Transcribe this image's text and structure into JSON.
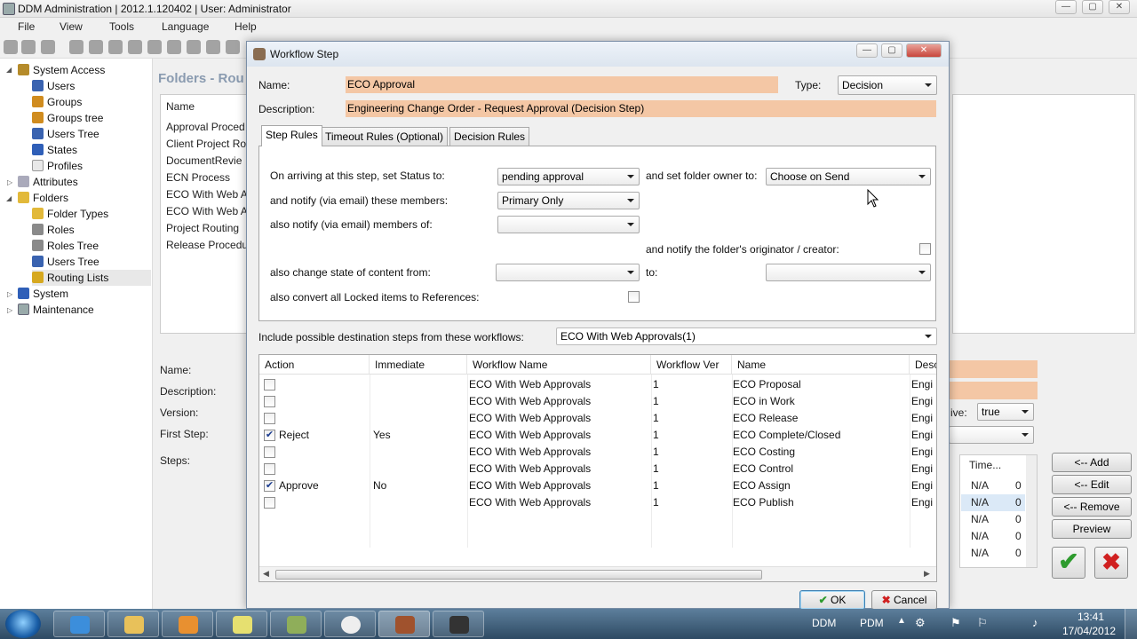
{
  "window": {
    "title": "DDM Administration | 2012.1.120402 | User:  Administrator",
    "buttons": {
      "minimize": "—",
      "maximize": "▢",
      "close": "✕"
    }
  },
  "menu": [
    "File",
    "View",
    "Tools",
    "Language",
    "Help"
  ],
  "toolbar_icons": [
    "user-add-icon",
    "user-icon",
    "group-icon",
    "chat-icon",
    "chat-icon",
    "chat-icon",
    "chat-icon",
    "route-icon",
    "route-icon",
    "route-icon",
    "route-icon",
    "route-icon",
    "route-icon",
    "route-icon",
    "route-icon",
    "route-icon",
    "route-icon",
    "route-icon",
    "route-icon",
    "route-icon",
    "route-icon",
    "route-icon",
    "route-icon"
  ],
  "tree": {
    "system_access": "System Access",
    "users": "Users",
    "groups": "Groups",
    "groups_tree": "Groups tree",
    "users_tree": "Users Tree",
    "states": "States",
    "profiles": "Profiles",
    "attributes": "Attributes",
    "folders": "Folders",
    "folder_types": "Folder Types",
    "roles": "Roles",
    "roles_tree": "Roles Tree",
    "users_tree2": "Users Tree",
    "routing_lists": "Routing Lists",
    "system": "System",
    "maintenance": "Maintenance"
  },
  "background": {
    "panel_title": "Folders - Rou",
    "list_header": "Name",
    "list_items": [
      "Approval Proced",
      "Client Project Ro",
      "DocumentRevie",
      "ECN Process",
      "ECO With Web A",
      "ECO With Web A",
      "Project Routing",
      "Release Procedu"
    ],
    "form_labels": {
      "name": "Name:",
      "description": "Description:",
      "version": "Version:",
      "first_step": "First Step:",
      "steps": "Steps:"
    },
    "active_label": "ive:",
    "active_value": "true",
    "steps_header": "Time...",
    "steps_rows": [
      [
        "N/A",
        "0"
      ],
      [
        "N/A",
        "0"
      ],
      [
        "N/A",
        "0"
      ],
      [
        "N/A",
        "0"
      ],
      [
        "N/A",
        "0"
      ]
    ],
    "buttons": {
      "add": "<-- Add",
      "edit": "<-- Edit",
      "remove": "<-- Remove",
      "preview": "Preview"
    }
  },
  "dialog": {
    "title": "Workflow Step",
    "name_label": "Name:",
    "name_value": "ECO Approval",
    "type_label": "Type:",
    "type_value": "Decision",
    "description_label": "Description:",
    "description_value": "Engineering Change Order - Request Approval (Decision Step)",
    "tabs": [
      "Step Rules",
      "Timeout Rules (Optional)",
      "Decision Rules"
    ],
    "rules": {
      "status_label": "On arriving at this step, set Status to:",
      "status_value": "pending approval",
      "owner_label": "and set folder owner to:",
      "owner_value": "Choose on Send",
      "notify_label": "and notify (via email) these members:",
      "notify_value": "Primary Only",
      "also_notify_label": "also notify (via email) members of:",
      "also_notify_value": "",
      "originator_label": "and notify the folder's originator / creator:",
      "change_state_label": "also change state of content from:",
      "change_state_from": "",
      "to_label": "to:",
      "change_state_to": "",
      "convert_label": "also convert all Locked items to References:"
    },
    "include_label": "Include possible destination steps from these workflows:",
    "include_value": "ECO With Web Approvals(1)",
    "grid": {
      "headers": [
        "Action",
        "Immediate",
        "Workflow Name",
        "Workflow Ver",
        "Name",
        "Desc"
      ],
      "rows": [
        {
          "checked": false,
          "action": "",
          "immediate": "",
          "workflow": "ECO With Web Approvals",
          "ver": "1",
          "name": "ECO Proposal",
          "desc": "Engi"
        },
        {
          "checked": false,
          "action": "",
          "immediate": "",
          "workflow": "ECO With Web Approvals",
          "ver": "1",
          "name": "ECO in Work",
          "desc": "Engi"
        },
        {
          "checked": false,
          "action": "",
          "immediate": "",
          "workflow": "ECO With Web Approvals",
          "ver": "1",
          "name": "ECO Release",
          "desc": "Engi"
        },
        {
          "checked": true,
          "action": "Reject",
          "immediate": "Yes",
          "workflow": "ECO With Web Approvals",
          "ver": "1",
          "name": "ECO Complete/Closed",
          "desc": "Engi"
        },
        {
          "checked": false,
          "action": "",
          "immediate": "",
          "workflow": "ECO With Web Approvals",
          "ver": "1",
          "name": "ECO Costing",
          "desc": "Engi"
        },
        {
          "checked": false,
          "action": "",
          "immediate": "",
          "workflow": "ECO With Web Approvals",
          "ver": "1",
          "name": "ECO Control",
          "desc": "Engi"
        },
        {
          "checked": true,
          "action": "Approve",
          "immediate": "No",
          "workflow": "ECO With Web Approvals",
          "ver": "1",
          "name": "ECO Assign",
          "desc": "Engi"
        },
        {
          "checked": false,
          "action": "",
          "immediate": "",
          "workflow": "ECO With Web Approvals",
          "ver": "1",
          "name": "ECO Publish",
          "desc": "Engi"
        }
      ]
    },
    "ok": "OK",
    "cancel": "Cancel"
  },
  "taskbar": {
    "tray_ddm": "DDM",
    "tray_pdm": "PDM",
    "time": "13:41",
    "date": "17/04/2012"
  },
  "colors": {
    "accent_field": "#f4c7a5",
    "ok_green": "#2e9b2e",
    "cancel_red": "#d02020"
  }
}
